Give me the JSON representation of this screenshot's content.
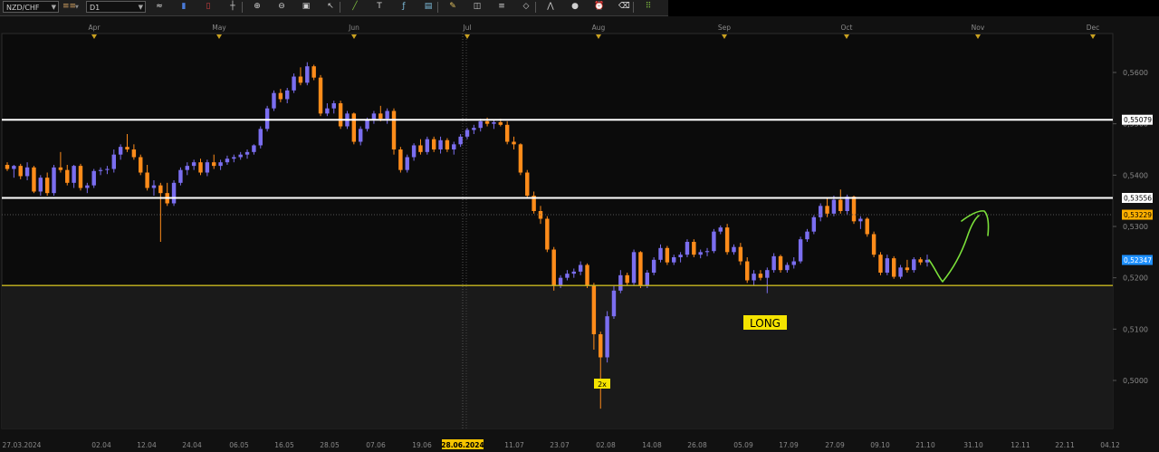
{
  "toolbar": {
    "symbol": "NZD/CHF",
    "chart_type_label": "≡≡",
    "timeframe": "D1",
    "icons": [
      "chart-style-icon",
      "bar-chart-icon",
      "candle-chart-icon",
      "crosshair-icon",
      "zoom-in-icon",
      "zoom-out-icon",
      "fit-icon",
      "cursor-icon",
      "line-tool-icon",
      "text-icon",
      "indicator-icon",
      "template-icon",
      "pencil-icon",
      "objects-icon",
      "fibonacci-icon",
      "shapes-icon",
      "pattern-icon",
      "circle-icon",
      "alert-icon",
      "eraser-icon",
      "grid-icon"
    ]
  },
  "chart_data": {
    "type": "candlestick",
    "symbol": "NZD/CHF",
    "timeframe": "D1",
    "month_labels": [
      "Apr",
      "May",
      "Jun",
      "Jul",
      "Aug",
      "Sep",
      "Oct",
      "Nov",
      "Dec"
    ],
    "date_labels": [
      "27.03.2024",
      "02.04",
      "12.04",
      "24.04",
      "06.05",
      "16.05",
      "28.05",
      "07.06",
      "19.06",
      "28.06.2024",
      "11.07",
      "23.07",
      "02.08",
      "14.08",
      "26.08",
      "05.09",
      "17.09",
      "27.09",
      "09.10",
      "21.10",
      "31.10",
      "12.11",
      "22.11",
      "04.12"
    ],
    "crosshair_date": "28.06.2024",
    "price_labels": [
      "0,5600",
      "0,5500",
      "0,5400",
      "0,5300",
      "0,5200",
      "0,5100",
      "0,5000"
    ],
    "price_values": [
      0.56,
      0.55,
      0.54,
      0.53,
      0.52,
      0.51,
      0.5
    ],
    "ylim": [
      0.4915,
      0.5685
    ],
    "levels": [
      {
        "label": "0,55079",
        "value": 0.55079,
        "color": "#ffffff",
        "box_bg": "#ffffff",
        "box_fg": "#000000"
      },
      {
        "label": "0,53556",
        "value": 0.53556,
        "color": "#ffffff",
        "box_bg": "#ffffff",
        "box_fg": "#000000"
      },
      {
        "label": "0,53229",
        "value": 0.53229,
        "color": "#ffb000",
        "box_bg": "#ffb000",
        "box_fg": "#000000",
        "dashed": true
      },
      {
        "label": "0,52347",
        "value": 0.52347,
        "color": "#1e90ff",
        "box_bg": "#1e90ff",
        "box_fg": "#ffffff"
      }
    ],
    "support_line": {
      "value": 0.5185,
      "color": "#c8b820"
    },
    "annotations": [
      {
        "text": "LONG",
        "bg": "#f5e400",
        "fg": "#000000"
      },
      {
        "text": "2x",
        "bg": "#f5e400",
        "fg": "#000000"
      }
    ],
    "colors": {
      "bull": "#7b6ef0",
      "bear": "#ff8c1a",
      "background": "#0b0b0b",
      "lower_zone": "#1a1a1a",
      "grid": "#2a2a2a",
      "arrow": "#7be03a"
    },
    "candles": [
      {
        "o": 0.542,
        "h": 0.5425,
        "l": 0.5408,
        "c": 0.5412
      },
      {
        "o": 0.5412,
        "h": 0.542,
        "l": 0.5395,
        "c": 0.5418
      },
      {
        "o": 0.5418,
        "h": 0.5422,
        "l": 0.5392,
        "c": 0.5398
      },
      {
        "o": 0.5398,
        "h": 0.5425,
        "l": 0.539,
        "c": 0.5415
      },
      {
        "o": 0.5415,
        "h": 0.5418,
        "l": 0.5365,
        "c": 0.5368
      },
      {
        "o": 0.5368,
        "h": 0.54,
        "l": 0.536,
        "c": 0.5395
      },
      {
        "o": 0.5395,
        "h": 0.5405,
        "l": 0.536,
        "c": 0.5365
      },
      {
        "o": 0.5365,
        "h": 0.542,
        "l": 0.536,
        "c": 0.5415
      },
      {
        "o": 0.5415,
        "h": 0.5445,
        "l": 0.5405,
        "c": 0.541
      },
      {
        "o": 0.541,
        "h": 0.542,
        "l": 0.538,
        "c": 0.5385
      },
      {
        "o": 0.5385,
        "h": 0.542,
        "l": 0.5375,
        "c": 0.5418
      },
      {
        "o": 0.5418,
        "h": 0.5422,
        "l": 0.537,
        "c": 0.5375
      },
      {
        "o": 0.5375,
        "h": 0.5385,
        "l": 0.5365,
        "c": 0.538
      },
      {
        "o": 0.538,
        "h": 0.5412,
        "l": 0.5375,
        "c": 0.5408
      },
      {
        "o": 0.5408,
        "h": 0.5415,
        "l": 0.54,
        "c": 0.541
      },
      {
        "o": 0.541,
        "h": 0.5418,
        "l": 0.5402,
        "c": 0.5412
      },
      {
        "o": 0.5412,
        "h": 0.545,
        "l": 0.5405,
        "c": 0.544
      },
      {
        "o": 0.544,
        "h": 0.546,
        "l": 0.543,
        "c": 0.5455
      },
      {
        "o": 0.5455,
        "h": 0.548,
        "l": 0.5445,
        "c": 0.545
      },
      {
        "o": 0.545,
        "h": 0.546,
        "l": 0.543,
        "c": 0.5435
      },
      {
        "o": 0.5435,
        "h": 0.544,
        "l": 0.54,
        "c": 0.5405
      },
      {
        "o": 0.5405,
        "h": 0.542,
        "l": 0.537,
        "c": 0.5375
      },
      {
        "o": 0.5375,
        "h": 0.539,
        "l": 0.536,
        "c": 0.538
      },
      {
        "o": 0.538,
        "h": 0.5385,
        "l": 0.527,
        "c": 0.5365
      },
      {
        "o": 0.5365,
        "h": 0.5385,
        "l": 0.534,
        "c": 0.5345
      },
      {
        "o": 0.5345,
        "h": 0.539,
        "l": 0.534,
        "c": 0.5385
      },
      {
        "o": 0.5385,
        "h": 0.5415,
        "l": 0.538,
        "c": 0.541
      },
      {
        "o": 0.541,
        "h": 0.5425,
        "l": 0.54,
        "c": 0.5418
      },
      {
        "o": 0.5418,
        "h": 0.543,
        "l": 0.541,
        "c": 0.5425
      },
      {
        "o": 0.5425,
        "h": 0.5432,
        "l": 0.54,
        "c": 0.5405
      },
      {
        "o": 0.5405,
        "h": 0.543,
        "l": 0.5398,
        "c": 0.5425
      },
      {
        "o": 0.5425,
        "h": 0.544,
        "l": 0.5412,
        "c": 0.5418
      },
      {
        "o": 0.5418,
        "h": 0.543,
        "l": 0.541,
        "c": 0.5425
      },
      {
        "o": 0.5425,
        "h": 0.5438,
        "l": 0.542,
        "c": 0.5432
      },
      {
        "o": 0.5432,
        "h": 0.544,
        "l": 0.5425,
        "c": 0.5435
      },
      {
        "o": 0.5435,
        "h": 0.5445,
        "l": 0.543,
        "c": 0.544
      },
      {
        "o": 0.544,
        "h": 0.545,
        "l": 0.5432,
        "c": 0.5445
      },
      {
        "o": 0.5445,
        "h": 0.546,
        "l": 0.544,
        "c": 0.5458
      },
      {
        "o": 0.5458,
        "h": 0.5495,
        "l": 0.5452,
        "c": 0.549
      },
      {
        "o": 0.549,
        "h": 0.5535,
        "l": 0.5485,
        "c": 0.553
      },
      {
        "o": 0.553,
        "h": 0.5565,
        "l": 0.5525,
        "c": 0.556
      },
      {
        "o": 0.556,
        "h": 0.5568,
        "l": 0.5542,
        "c": 0.5548
      },
      {
        "o": 0.5548,
        "h": 0.557,
        "l": 0.554,
        "c": 0.5565
      },
      {
        "o": 0.5565,
        "h": 0.5598,
        "l": 0.556,
        "c": 0.5592
      },
      {
        "o": 0.5592,
        "h": 0.561,
        "l": 0.5575,
        "c": 0.558
      },
      {
        "o": 0.558,
        "h": 0.562,
        "l": 0.5575,
        "c": 0.5612
      },
      {
        "o": 0.5612,
        "h": 0.5615,
        "l": 0.5585,
        "c": 0.559
      },
      {
        "o": 0.559,
        "h": 0.5595,
        "l": 0.5515,
        "c": 0.552
      },
      {
        "o": 0.552,
        "h": 0.554,
        "l": 0.5515,
        "c": 0.553
      },
      {
        "o": 0.553,
        "h": 0.5545,
        "l": 0.552,
        "c": 0.554
      },
      {
        "o": 0.554,
        "h": 0.5545,
        "l": 0.549,
        "c": 0.5495
      },
      {
        "o": 0.5495,
        "h": 0.5525,
        "l": 0.549,
        "c": 0.552
      },
      {
        "o": 0.552,
        "h": 0.5522,
        "l": 0.546,
        "c": 0.5465
      },
      {
        "o": 0.5465,
        "h": 0.5495,
        "l": 0.5458,
        "c": 0.549
      },
      {
        "o": 0.549,
        "h": 0.5512,
        "l": 0.5485,
        "c": 0.5508
      },
      {
        "o": 0.5508,
        "h": 0.5525,
        "l": 0.55,
        "c": 0.552
      },
      {
        "o": 0.552,
        "h": 0.5535,
        "l": 0.5505,
        "c": 0.551
      },
      {
        "o": 0.551,
        "h": 0.553,
        "l": 0.55,
        "c": 0.5525
      },
      {
        "o": 0.5525,
        "h": 0.553,
        "l": 0.544,
        "c": 0.545
      },
      {
        "o": 0.545,
        "h": 0.5455,
        "l": 0.5405,
        "c": 0.541
      },
      {
        "o": 0.541,
        "h": 0.544,
        "l": 0.5405,
        "c": 0.5435
      },
      {
        "o": 0.5435,
        "h": 0.5462,
        "l": 0.5428,
        "c": 0.5458
      },
      {
        "o": 0.5458,
        "h": 0.547,
        "l": 0.544,
        "c": 0.5445
      },
      {
        "o": 0.5445,
        "h": 0.5475,
        "l": 0.544,
        "c": 0.547
      },
      {
        "o": 0.547,
        "h": 0.5475,
        "l": 0.5445,
        "c": 0.545
      },
      {
        "o": 0.545,
        "h": 0.5475,
        "l": 0.5442,
        "c": 0.5468
      },
      {
        "o": 0.5468,
        "h": 0.5472,
        "l": 0.5445,
        "c": 0.545
      },
      {
        "o": 0.545,
        "h": 0.5465,
        "l": 0.544,
        "c": 0.546
      },
      {
        "o": 0.546,
        "h": 0.548,
        "l": 0.5455,
        "c": 0.5475
      },
      {
        "o": 0.5475,
        "h": 0.5492,
        "l": 0.547,
        "c": 0.5488
      },
      {
        "o": 0.5488,
        "h": 0.5498,
        "l": 0.548,
        "c": 0.5492
      },
      {
        "o": 0.5492,
        "h": 0.551,
        "l": 0.5485,
        "c": 0.5505
      },
      {
        "o": 0.5505,
        "h": 0.5512,
        "l": 0.5495,
        "c": 0.55
      },
      {
        "o": 0.55,
        "h": 0.5508,
        "l": 0.549,
        "c": 0.5503
      },
      {
        "o": 0.5503,
        "h": 0.551,
        "l": 0.5495,
        "c": 0.5498
      },
      {
        "o": 0.5498,
        "h": 0.5505,
        "l": 0.546,
        "c": 0.5465
      },
      {
        "o": 0.5465,
        "h": 0.5475,
        "l": 0.545,
        "c": 0.546
      },
      {
        "o": 0.546,
        "h": 0.5462,
        "l": 0.54,
        "c": 0.5405
      },
      {
        "o": 0.5405,
        "h": 0.541,
        "l": 0.5355,
        "c": 0.536
      },
      {
        "o": 0.536,
        "h": 0.5368,
        "l": 0.5325,
        "c": 0.533
      },
      {
        "o": 0.533,
        "h": 0.534,
        "l": 0.5305,
        "c": 0.5315
      },
      {
        "o": 0.5315,
        "h": 0.532,
        "l": 0.525,
        "c": 0.5255
      },
      {
        "o": 0.5255,
        "h": 0.526,
        "l": 0.5175,
        "c": 0.5185
      },
      {
        "o": 0.5185,
        "h": 0.5205,
        "l": 0.518,
        "c": 0.52
      },
      {
        "o": 0.52,
        "h": 0.5215,
        "l": 0.5195,
        "c": 0.5208
      },
      {
        "o": 0.5208,
        "h": 0.5218,
        "l": 0.52,
        "c": 0.5212
      },
      {
        "o": 0.5212,
        "h": 0.5232,
        "l": 0.5205,
        "c": 0.5225
      },
      {
        "o": 0.5225,
        "h": 0.5228,
        "l": 0.518,
        "c": 0.5185
      },
      {
        "o": 0.5185,
        "h": 0.519,
        "l": 0.506,
        "c": 0.509
      },
      {
        "o": 0.509,
        "h": 0.5095,
        "l": 0.4945,
        "c": 0.5045
      },
      {
        "o": 0.5045,
        "h": 0.5135,
        "l": 0.5035,
        "c": 0.5125
      },
      {
        "o": 0.5125,
        "h": 0.5185,
        "l": 0.512,
        "c": 0.5175
      },
      {
        "o": 0.5175,
        "h": 0.5215,
        "l": 0.517,
        "c": 0.5205
      },
      {
        "o": 0.5205,
        "h": 0.521,
        "l": 0.5185,
        "c": 0.519
      },
      {
        "o": 0.519,
        "h": 0.5255,
        "l": 0.5185,
        "c": 0.525
      },
      {
        "o": 0.525,
        "h": 0.5252,
        "l": 0.518,
        "c": 0.5185
      },
      {
        "o": 0.5185,
        "h": 0.5215,
        "l": 0.518,
        "c": 0.521
      },
      {
        "o": 0.521,
        "h": 0.524,
        "l": 0.5205,
        "c": 0.5235
      },
      {
        "o": 0.5235,
        "h": 0.5265,
        "l": 0.523,
        "c": 0.5258
      },
      {
        "o": 0.5258,
        "h": 0.5262,
        "l": 0.5225,
        "c": 0.523
      },
      {
        "o": 0.523,
        "h": 0.5245,
        "l": 0.5225,
        "c": 0.524
      },
      {
        "o": 0.524,
        "h": 0.525,
        "l": 0.523,
        "c": 0.5245
      },
      {
        "o": 0.5245,
        "h": 0.5275,
        "l": 0.524,
        "c": 0.527
      },
      {
        "o": 0.527,
        "h": 0.5275,
        "l": 0.524,
        "c": 0.5245
      },
      {
        "o": 0.5245,
        "h": 0.5255,
        "l": 0.5238,
        "c": 0.525
      },
      {
        "o": 0.525,
        "h": 0.5258,
        "l": 0.5242,
        "c": 0.5252
      },
      {
        "o": 0.5252,
        "h": 0.5295,
        "l": 0.5248,
        "c": 0.529
      },
      {
        "o": 0.529,
        "h": 0.5302,
        "l": 0.5285,
        "c": 0.5298
      },
      {
        "o": 0.5298,
        "h": 0.5305,
        "l": 0.5245,
        "c": 0.525
      },
      {
        "o": 0.525,
        "h": 0.5265,
        "l": 0.5245,
        "c": 0.526
      },
      {
        "o": 0.526,
        "h": 0.5268,
        "l": 0.5225,
        "c": 0.5232
      },
      {
        "o": 0.5232,
        "h": 0.524,
        "l": 0.519,
        "c": 0.5195
      },
      {
        "o": 0.5195,
        "h": 0.5215,
        "l": 0.5185,
        "c": 0.5208
      },
      {
        "o": 0.5208,
        "h": 0.5215,
        "l": 0.5195,
        "c": 0.52
      },
      {
        "o": 0.52,
        "h": 0.522,
        "l": 0.517,
        "c": 0.5215
      },
      {
        "o": 0.5215,
        "h": 0.5248,
        "l": 0.521,
        "c": 0.5242
      },
      {
        "o": 0.5242,
        "h": 0.5245,
        "l": 0.521,
        "c": 0.5215
      },
      {
        "o": 0.5215,
        "h": 0.523,
        "l": 0.521,
        "c": 0.5225
      },
      {
        "o": 0.5225,
        "h": 0.524,
        "l": 0.5218,
        "c": 0.5232
      },
      {
        "o": 0.5232,
        "h": 0.528,
        "l": 0.5228,
        "c": 0.5275
      },
      {
        "o": 0.5275,
        "h": 0.5295,
        "l": 0.527,
        "c": 0.529
      },
      {
        "o": 0.529,
        "h": 0.5322,
        "l": 0.5285,
        "c": 0.5318
      },
      {
        "o": 0.5318,
        "h": 0.5345,
        "l": 0.531,
        "c": 0.534
      },
      {
        "o": 0.534,
        "h": 0.5355,
        "l": 0.5318,
        "c": 0.5325
      },
      {
        "o": 0.5325,
        "h": 0.536,
        "l": 0.532,
        "c": 0.5352
      },
      {
        "o": 0.5352,
        "h": 0.5372,
        "l": 0.5325,
        "c": 0.533
      },
      {
        "o": 0.533,
        "h": 0.5362,
        "l": 0.5322,
        "c": 0.5358
      },
      {
        "o": 0.5358,
        "h": 0.536,
        "l": 0.5305,
        "c": 0.531
      },
      {
        "o": 0.531,
        "h": 0.532,
        "l": 0.5295,
        "c": 0.5315
      },
      {
        "o": 0.5315,
        "h": 0.5318,
        "l": 0.528,
        "c": 0.5285
      },
      {
        "o": 0.5285,
        "h": 0.529,
        "l": 0.524,
        "c": 0.5245
      },
      {
        "o": 0.5245,
        "h": 0.525,
        "l": 0.5205,
        "c": 0.521
      },
      {
        "o": 0.521,
        "h": 0.5245,
        "l": 0.5205,
        "c": 0.5238
      },
      {
        "o": 0.5238,
        "h": 0.5242,
        "l": 0.5198,
        "c": 0.5202
      },
      {
        "o": 0.5202,
        "h": 0.5225,
        "l": 0.5198,
        "c": 0.522
      },
      {
        "o": 0.522,
        "h": 0.5235,
        "l": 0.521,
        "c": 0.5215
      },
      {
        "o": 0.5215,
        "h": 0.524,
        "l": 0.521,
        "c": 0.5236
      },
      {
        "o": 0.5236,
        "h": 0.524,
        "l": 0.5225,
        "c": 0.523
      },
      {
        "o": 0.523,
        "h": 0.5245,
        "l": 0.5222,
        "c": 0.5235
      }
    ]
  }
}
